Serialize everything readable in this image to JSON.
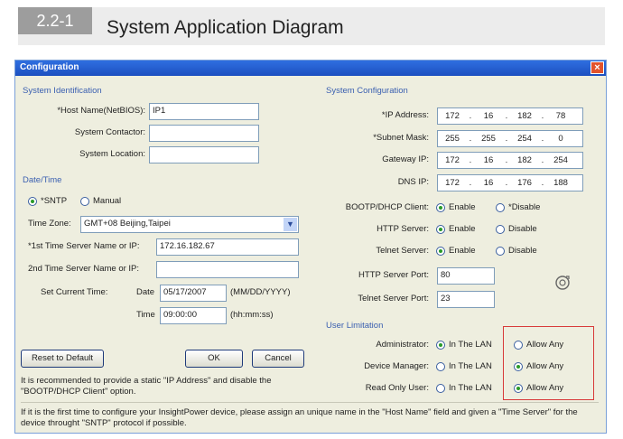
{
  "header": {
    "section_number": "2.2-1",
    "title": "System Application Diagram"
  },
  "window": {
    "title": "Configuration",
    "close_label": "×"
  },
  "system_identification": {
    "heading": "System Identification",
    "host_name_label": "*Host Name(NetBIOS):",
    "host_name_value": "IP1",
    "contactor_label": "System Contactor:",
    "contactor_value": "",
    "location_label": "System Location:",
    "location_value": ""
  },
  "datetime": {
    "heading": "Date/Time",
    "sntp_label": "*SNTP",
    "manual_label": "Manual",
    "timezone_label": "Time Zone:",
    "timezone_value": "GMT+08 Beijing,Taipei",
    "first_server_label": "*1st Time Server Name or IP:",
    "first_server_value": "172.16.182.67",
    "second_server_label": "2nd Time Server Name or IP:",
    "second_server_value": "",
    "set_time_label": "Set Current Time:",
    "date_label": "Date",
    "date_value": "05/17/2007",
    "date_format": "(MM/DD/YYYY)",
    "time_label": "Time",
    "time_value": "09:00:00",
    "time_format": "(hh:mm:ss)"
  },
  "buttons": {
    "reset": "Reset to Default",
    "ok": "OK",
    "cancel": "Cancel"
  },
  "note_static": "It is recommended to provide a static \"IP Address\" and disable the \"BOOTP/DHCP Client\" option.",
  "note_bottom": "If it is the first time to configure your InsightPower device, please assign an unique name in the \"Host Name\" field and given a \"Time Server\" for the device throught \"SNTP\" protocol if possible.",
  "system_configuration": {
    "heading": "System Configuration",
    "ip_label": "*IP Address:",
    "ip": [
      "172",
      "16",
      "182",
      "78"
    ],
    "mask_label": "*Subnet Mask:",
    "mask": [
      "255",
      "255",
      "254",
      "0"
    ],
    "gateway_label": "Gateway IP:",
    "gateway": [
      "172",
      "16",
      "182",
      "254"
    ],
    "dns_label": "DNS IP:",
    "dns": [
      "172",
      "16",
      "176",
      "188"
    ],
    "bootp_label": "BOOTP/DHCP Client:",
    "bootp_enable": "Enable",
    "bootp_disable": "*Disable",
    "http_label": "HTTP Server:",
    "http_enable": "Enable",
    "http_disable": "Disable",
    "telnet_label": "Telnet Server:",
    "telnet_enable": "Enable",
    "telnet_disable": "Disable",
    "http_port_label": "HTTP Server Port:",
    "http_port": "80",
    "telnet_port_label": "Telnet Server Port:",
    "telnet_port": "23"
  },
  "user_limitation": {
    "heading": "User Limitation",
    "admin_label": "Administrator:",
    "device_label": "Device Manager:",
    "readonly_label": "Read Only User:",
    "lan_label": "In The LAN",
    "any_label": "Allow Any"
  }
}
